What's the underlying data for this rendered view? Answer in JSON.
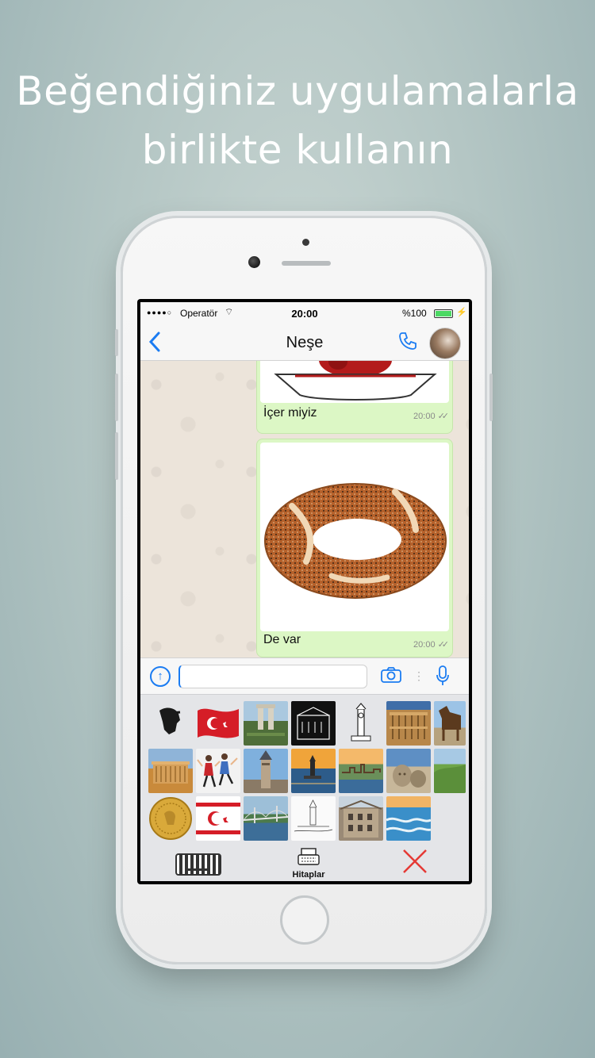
{
  "headline": {
    "line1": "Beğendiğiniz uygulamalarla",
    "line2": "birlikte kullanın"
  },
  "statusbar": {
    "carrier": "Operatör",
    "time": "20:00",
    "battery": "%100"
  },
  "navbar": {
    "back_icon": "chevron-left-icon",
    "contact_name": "Neşe",
    "call_icon": "phone-icon"
  },
  "messages": [
    {
      "caption": "İçer miyiz",
      "time": "20:00",
      "sticker": "tea-cup"
    },
    {
      "caption": "De var",
      "time": "20:00",
      "sticker": "simit"
    }
  ],
  "inputbar": {
    "value": "",
    "icons": [
      "upload-icon",
      "camera-icon",
      "mic-icon"
    ]
  },
  "keyboard": {
    "stickers": [
      "ataturk-silhouette",
      "turkish-flag-waving",
      "canakkale-memorial",
      "building-sketch",
      "izmir-clock-tower",
      "library-of-celsus",
      "trojan-horse",
      "anitkabir",
      "folk-dancers",
      "galata-tower",
      "maidens-tower-sunset",
      "istanbul-waterfront",
      "nemrut-heads",
      "green-hills",
      "gold-coin",
      "northern-cyprus-flag",
      "bosphorus-bridge",
      "maidens-tower-sketch",
      "ottoman-house",
      "pamukkale"
    ],
    "label": "Hitaplar",
    "icons": [
      "keyboard-icon",
      "typewriter-icon",
      "close-icon"
    ]
  },
  "colors": {
    "accent": "#1b7cf2",
    "bubble": "#dcf7c5",
    "close": "#e53935"
  }
}
